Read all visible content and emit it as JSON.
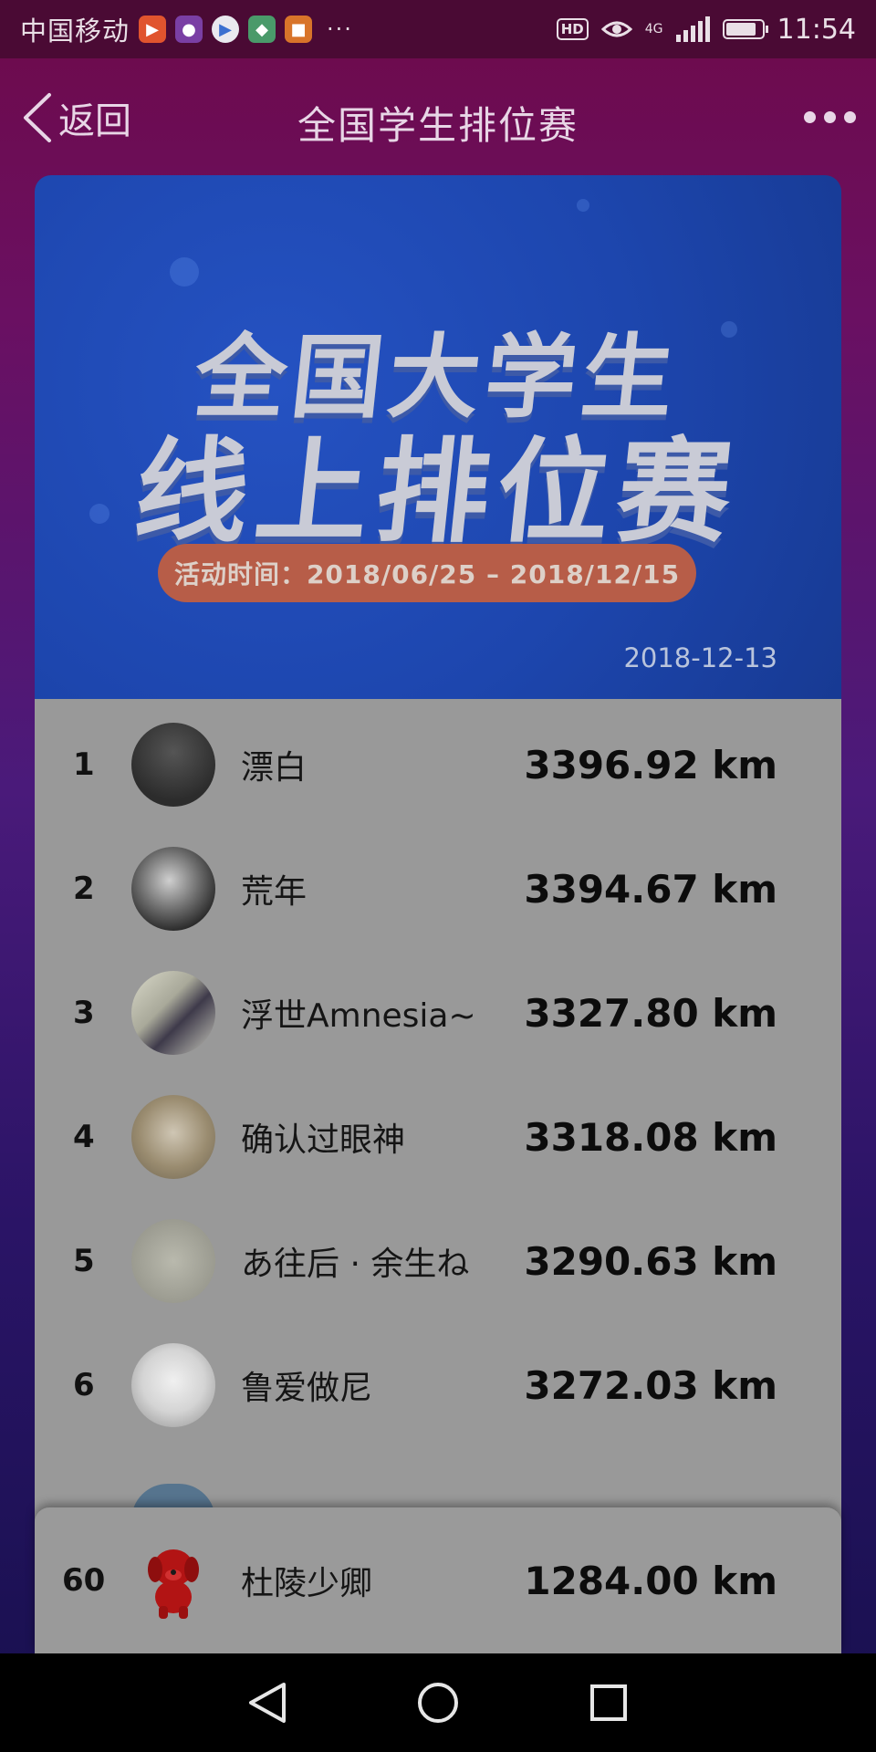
{
  "status_bar": {
    "carrier": "中国移动",
    "hd": "HD",
    "network": "4G",
    "time": "11:54",
    "more": "···",
    "battery_level": 0.85
  },
  "header": {
    "back_label": "返回",
    "title": "全国学生排位赛"
  },
  "banner": {
    "line1": "全国大学生",
    "line2": "线上排位赛",
    "period": "活动时间：2018/06/25 – 2018/12/15",
    "date": "2018-12-13"
  },
  "ranking": [
    {
      "rank": "1",
      "name": "漂白",
      "distance": "3396.92 km"
    },
    {
      "rank": "2",
      "name": "荒年",
      "distance": "3394.67 km"
    },
    {
      "rank": "3",
      "name": "浮世Amnesia~",
      "distance": "3327.80 km"
    },
    {
      "rank": "4",
      "name": "确认过眼神",
      "distance": "3318.08 km"
    },
    {
      "rank": "5",
      "name": "あ往后 · 余生ね",
      "distance": "3290.63 km"
    },
    {
      "rank": "6",
      "name": "鲁爱做尼",
      "distance": "3272.03 km"
    }
  ],
  "my_rank": {
    "rank": "60",
    "name": "杜陵少卿",
    "distance": "1284.00 km"
  }
}
